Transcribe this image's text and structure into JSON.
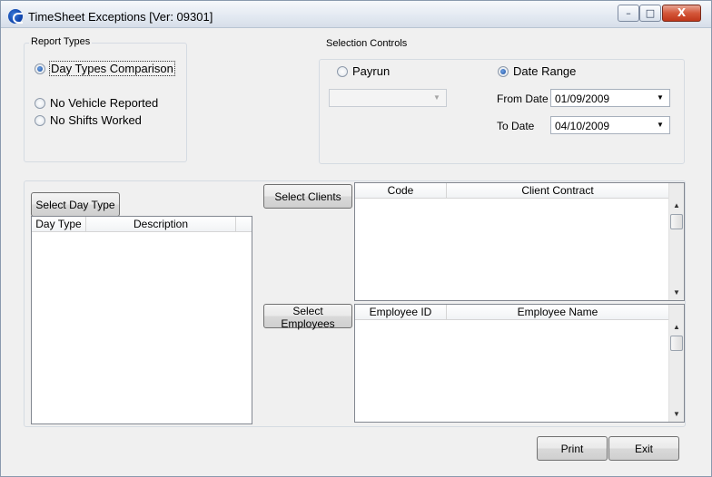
{
  "window": {
    "title": "TimeSheet Exceptions [Ver: 09301]",
    "controls": {
      "minimize": "–",
      "maximize": "□",
      "close": "X"
    }
  },
  "report_types": {
    "label": "Report Types",
    "options": [
      {
        "label": "Day Types Comparison",
        "selected": true
      },
      {
        "label": "No Vehicle Reported",
        "selected": false
      },
      {
        "label": "No Shifts Worked",
        "selected": false
      }
    ]
  },
  "selection_controls": {
    "label": "Selection Controls",
    "payrun": {
      "label": "Payrun",
      "selected": false,
      "value": ""
    },
    "date_range": {
      "label": "Date Range",
      "selected": true
    },
    "from_date": {
      "label": "From Date",
      "value": "01/09/2009"
    },
    "to_date": {
      "label": "To Date",
      "value": "04/10/2009"
    }
  },
  "day_types": {
    "button": "Select Day Type",
    "columns": [
      "Day Type",
      "Description"
    ]
  },
  "clients": {
    "button": "Select Clients",
    "columns": [
      "Code",
      "Client Contract"
    ]
  },
  "employees": {
    "button": "Select Employees",
    "columns": [
      "Employee ID",
      "Employee Name"
    ]
  },
  "footer": {
    "print": "Print",
    "exit": "Exit"
  },
  "glyphs": {
    "dropdown": "▼",
    "scroll_up": "▲",
    "scroll_down": "▼"
  }
}
